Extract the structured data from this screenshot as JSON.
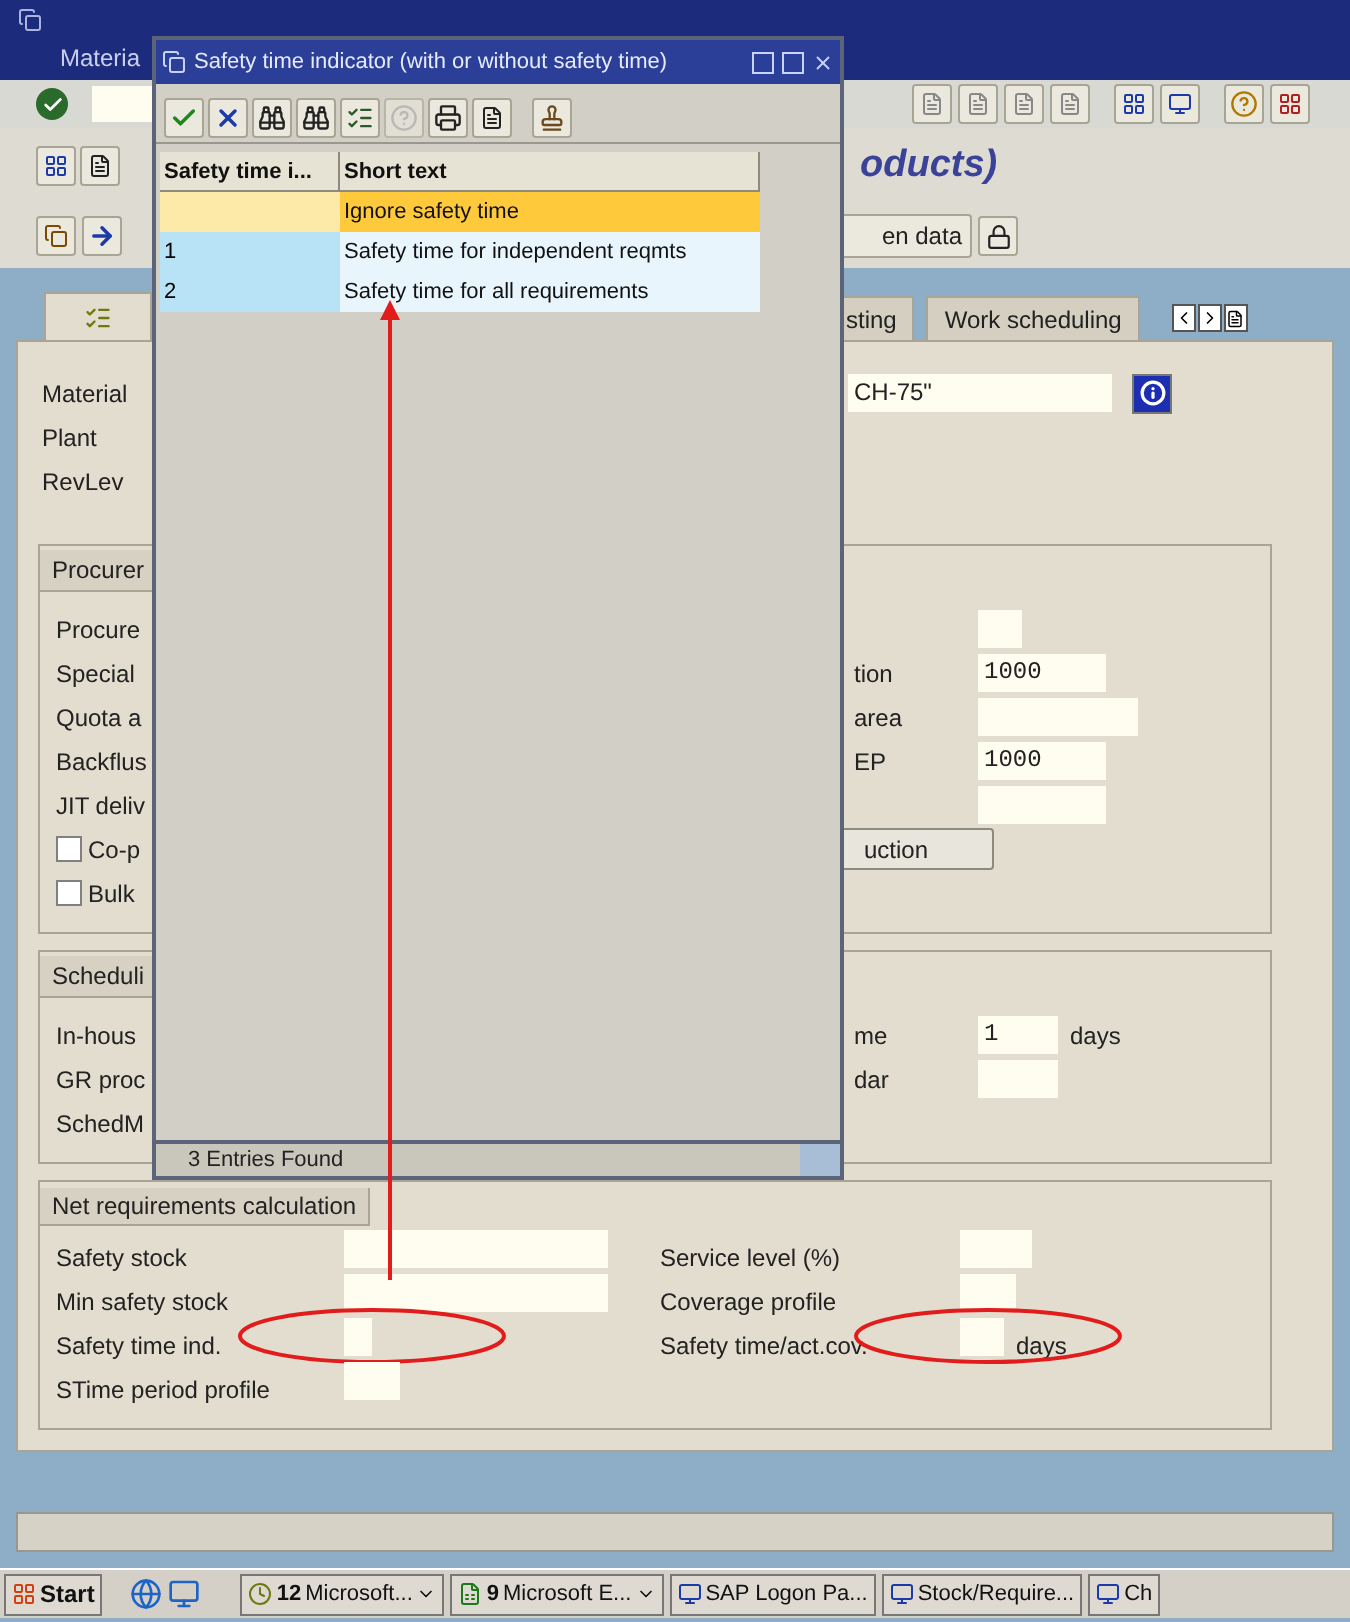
{
  "menu": {
    "items": [
      "Materia"
    ]
  },
  "screen_title": "oducts)",
  "app_toolbar": {
    "button": "en data"
  },
  "tabs": [
    {
      "kind": "icon",
      "selected": true
    },
    {
      "kind": "text",
      "label": "sting",
      "selected": false
    },
    {
      "kind": "text",
      "label": "Work scheduling",
      "selected": false
    }
  ],
  "header": {
    "fields": [
      {
        "label": "Material",
        "value": "CH-75\""
      },
      {
        "label": "Plant"
      },
      {
        "label": "RevLev"
      }
    ]
  },
  "groups": [
    {
      "title": "Procurer",
      "rows": [
        {
          "kind": "label",
          "label": "Procure",
          "right": {
            "kind": "field"
          }
        },
        {
          "kind": "label",
          "label": "Special",
          "right": {
            "kind": "field",
            "label": "tion",
            "value": "1000"
          }
        },
        {
          "kind": "label",
          "label": "Quota a",
          "right": {
            "kind": "field",
            "label": "area"
          }
        },
        {
          "kind": "label",
          "label": "Backflus",
          "right": {
            "kind": "field",
            "label": "EP",
            "value": "1000"
          }
        },
        {
          "kind": "label",
          "label": "JIT deliv",
          "right": {
            "kind": "field"
          }
        },
        {
          "kind": "checkbox",
          "label": "Co-p",
          "checked": false,
          "right": {
            "kind": "button",
            "label": "uction"
          }
        },
        {
          "kind": "checkbox",
          "label": "Bulk",
          "checked": false
        }
      ]
    },
    {
      "title": "Scheduli",
      "rows": [
        {
          "kind": "label",
          "label": "In-hous",
          "right": {
            "kind": "field",
            "label": "me",
            "value": "1",
            "unit": "days"
          }
        },
        {
          "kind": "label",
          "label": "GR proc",
          "right": {
            "kind": "field",
            "label": "dar"
          }
        },
        {
          "kind": "label",
          "label": "SchedM"
        }
      ]
    }
  ],
  "net_requirements": {
    "title": "Net requirements calculation",
    "rows": [
      {
        "left": {
          "label": "Safety stock",
          "circled": false
        },
        "right": {
          "label": "Service level (%)",
          "circled": false
        }
      },
      {
        "left": {
          "label": "Min safety stock",
          "circled": false
        },
        "right": {
          "label": "Coverage profile",
          "circled": false
        }
      },
      {
        "left": {
          "label": "Safety time ind.",
          "circled": true
        },
        "right": {
          "label": "Safety time/act.cov.",
          "unit": "days",
          "circled": true
        }
      },
      {
        "left": {
          "label": "STime period profile",
          "circled": false
        }
      }
    ]
  },
  "popup": {
    "title": "Safety time indicator (with or without safety time)",
    "columns": [
      "Safety time i...",
      "Short text"
    ],
    "rows": [
      {
        "text": "Ignore safety time",
        "selected": true
      },
      {
        "code": "1",
        "text": "Safety time for independent reqmts",
        "selected": false
      },
      {
        "code": "2",
        "text": "Safety time for all requirements",
        "selected": false
      }
    ],
    "status": "3 Entries Found"
  },
  "taskbar": {
    "start": "Start",
    "items": [
      {
        "count": "12",
        "label": "Microsoft...",
        "dropdown": true
      },
      {
        "count": "9",
        "label": "Microsoft E...",
        "dropdown": true
      },
      {
        "label": "SAP Logon Pa...",
        "dropdown": false
      },
      {
        "label": "Stock/Require...",
        "dropdown": false
      },
      {
        "label": "Ch",
        "dropdown": false
      }
    ]
  }
}
